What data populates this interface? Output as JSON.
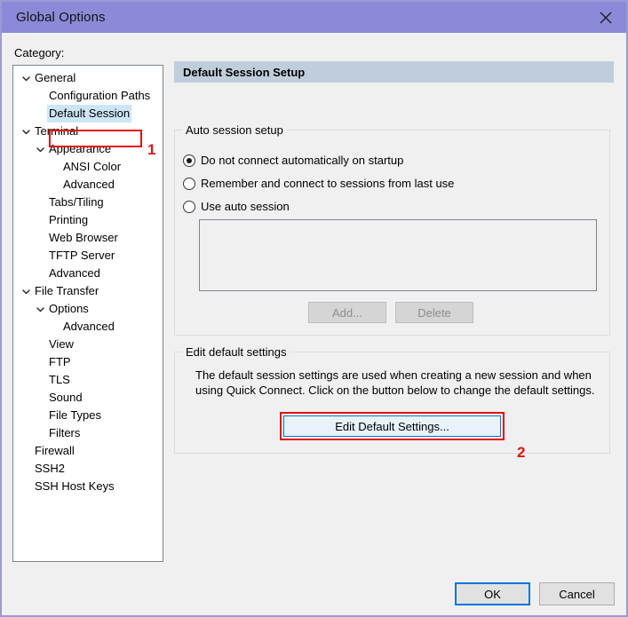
{
  "window": {
    "title": "Global Options",
    "close_icon": "close-icon",
    "accent_title_bar": "#8a8ad8"
  },
  "sidebar": {
    "label": "Category:",
    "items": [
      {
        "label": "General",
        "level": 0,
        "expander": "chevron-down-icon",
        "selected": false
      },
      {
        "label": "Configuration Paths",
        "level": 1,
        "expander": "none",
        "selected": false
      },
      {
        "label": "Default Session",
        "level": 1,
        "expander": "none",
        "selected": true
      },
      {
        "label": "Terminal",
        "level": 0,
        "expander": "chevron-down-icon",
        "selected": false
      },
      {
        "label": "Appearance",
        "level": 1,
        "expander": "chevron-down-icon",
        "selected": false
      },
      {
        "label": "ANSI Color",
        "level": 2,
        "expander": "none",
        "selected": false
      },
      {
        "label": "Advanced",
        "level": 2,
        "expander": "none",
        "selected": false
      },
      {
        "label": "Tabs/Tiling",
        "level": 1,
        "expander": "none",
        "selected": false
      },
      {
        "label": "Printing",
        "level": 1,
        "expander": "none",
        "selected": false
      },
      {
        "label": "Web Browser",
        "level": 1,
        "expander": "none",
        "selected": false
      },
      {
        "label": "TFTP Server",
        "level": 1,
        "expander": "none",
        "selected": false
      },
      {
        "label": "Advanced",
        "level": 1,
        "expander": "none",
        "selected": false
      },
      {
        "label": "File Transfer",
        "level": 0,
        "expander": "chevron-down-icon",
        "selected": false
      },
      {
        "label": "Options",
        "level": 1,
        "expander": "chevron-down-icon",
        "selected": false
      },
      {
        "label": "Advanced",
        "level": 2,
        "expander": "none",
        "selected": false
      },
      {
        "label": "View",
        "level": 1,
        "expander": "none",
        "selected": false
      },
      {
        "label": "FTP",
        "level": 1,
        "expander": "none",
        "selected": false
      },
      {
        "label": "TLS",
        "level": 1,
        "expander": "none",
        "selected": false
      },
      {
        "label": "Sound",
        "level": 1,
        "expander": "none",
        "selected": false
      },
      {
        "label": "File Types",
        "level": 1,
        "expander": "none",
        "selected": false
      },
      {
        "label": "Filters",
        "level": 1,
        "expander": "none",
        "selected": false
      },
      {
        "label": "Firewall",
        "level": 0,
        "expander": "none",
        "selected": false
      },
      {
        "label": "SSH2",
        "level": 0,
        "expander": "none",
        "selected": false
      },
      {
        "label": "SSH Host Keys",
        "level": 0,
        "expander": "none",
        "selected": false
      }
    ]
  },
  "main": {
    "header": "Default Session Setup",
    "auto_session": {
      "legend": "Auto session setup",
      "options": [
        {
          "label": "Do not connect automatically on startup",
          "checked": true
        },
        {
          "label": "Remember and connect to sessions from last use",
          "checked": false
        },
        {
          "label": "Use auto session",
          "checked": false
        }
      ],
      "list_items": [],
      "add_button": "Add...",
      "add_button_enabled": false,
      "delete_button": "Delete",
      "delete_button_enabled": false
    },
    "edit_defaults": {
      "legend": "Edit default settings",
      "description": "The default session settings are used when creating a new session and when using Quick Connect.  Click on the button below to change the default settings.",
      "button": "Edit Default Settings..."
    }
  },
  "footer": {
    "ok": "OK",
    "cancel": "Cancel"
  },
  "annotations": {
    "color": "#e8130e",
    "markers": [
      {
        "number": "1",
        "target": "Default Session"
      },
      {
        "number": "2",
        "target": "Edit Default Settings..."
      }
    ]
  }
}
